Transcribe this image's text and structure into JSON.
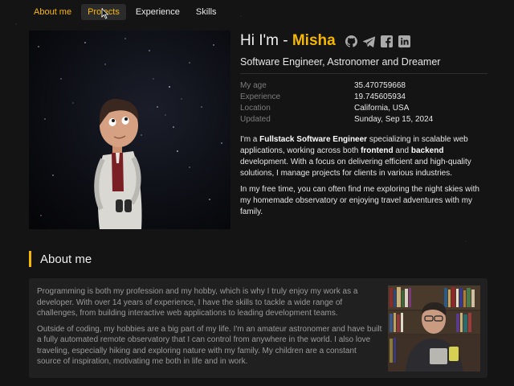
{
  "nav": {
    "items": [
      {
        "label": "About me",
        "state": "active"
      },
      {
        "label": "Projects",
        "state": "hover"
      },
      {
        "label": "Experience",
        "state": "normal"
      },
      {
        "label": "Skills",
        "state": "normal"
      }
    ]
  },
  "hero": {
    "greeting": "Hi I'm - ",
    "name": "Misha",
    "subtitle": "Software Engineer, Astronomer and Dreamer",
    "socials": [
      "github-icon",
      "telegram-icon",
      "facebook-icon",
      "linkedin-icon"
    ]
  },
  "facts": [
    {
      "label": "My age",
      "value": "35.470759668"
    },
    {
      "label": "Experience",
      "value": "19.745605934"
    },
    {
      "label": "Location",
      "value": "California, USA"
    },
    {
      "label": "Updated",
      "value": "Sunday, Sep 15, 2024"
    }
  ],
  "bio": {
    "p1": {
      "t1": "I'm a ",
      "b1": "Fullstack Software Engineer",
      "t2": " specializing in scalable web applications, working across both ",
      "b2": "frontend",
      "t3": " and ",
      "b3": "backend",
      "t4": " development. With a focus on delivering efficient and high-quality solutions, I manage projects for clients in various industries."
    },
    "p2": "In my free time, you can often find me exploring the night skies with my homemade observatory or enjoying travel adventures with my family."
  },
  "about": {
    "heading": "About me",
    "p1": "Programming is both my profession and my hobby, which is why I truly enjoy my work as a developer. With over 14 years of experience, I have the skills to tackle a wide range of challenges, from building interactive web applications to leading development teams.",
    "p2": "Outside of coding, my hobbies are a big part of my life. I'm an amateur astronomer and have built a fully automated remote observatory that I can control from anywhere in the world. I also love traveling, especially hiking and exploring nature with my family. My children are a constant source of inspiration, motivating me both in life and in work."
  },
  "colors": {
    "accent": "#f5b800",
    "background": "#141414",
    "card": "#202020"
  }
}
